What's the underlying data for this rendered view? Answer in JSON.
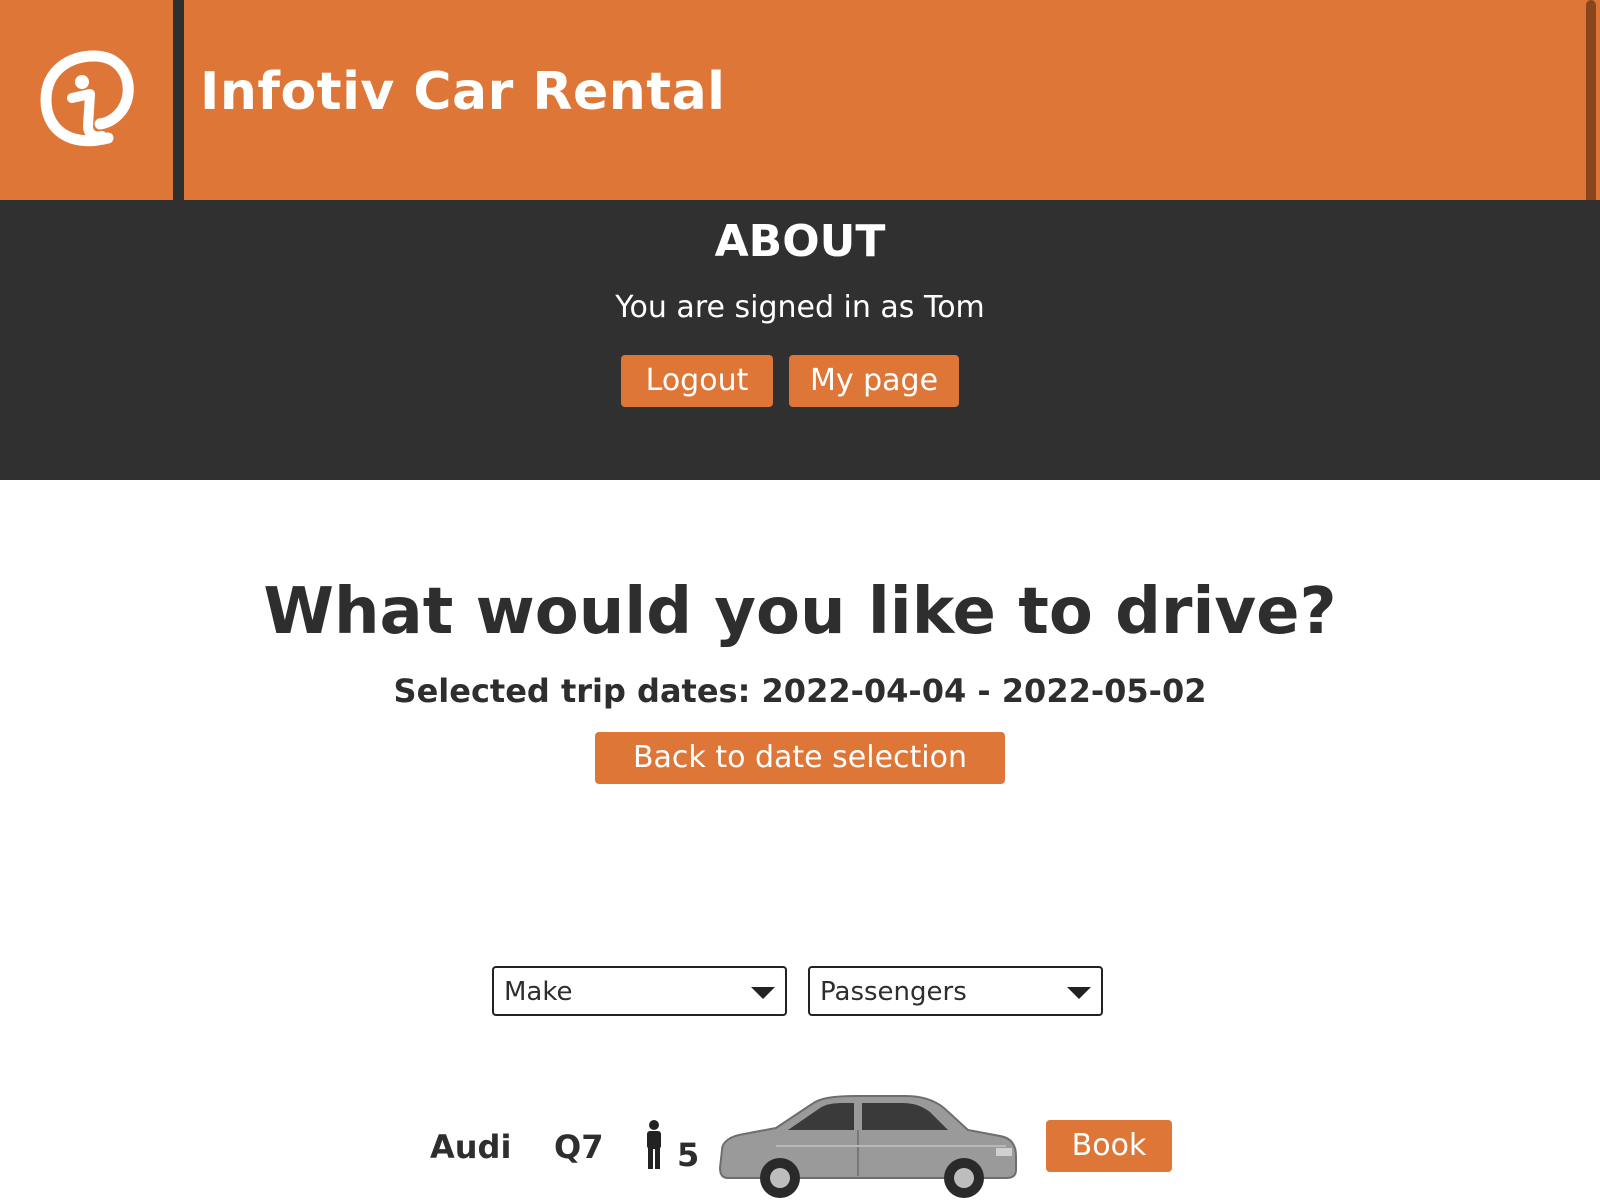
{
  "header": {
    "title": "Infotiv Car Rental",
    "logo_icon": "infotiv-logo-icon",
    "brand_color": "#de7638"
  },
  "about": {
    "heading": "ABOUT",
    "signed_in_text": "You are signed in as Tom",
    "logout_label": "Logout",
    "my_page_label": "My page"
  },
  "main": {
    "heading": "What would you like to drive?",
    "trip_dates": "Selected trip dates: 2022-04-04 - 2022-05-02",
    "back_label": "Back to date selection"
  },
  "filters": {
    "make_label": "Make",
    "passengers_label": "Passengers"
  },
  "cars": [
    {
      "make": "Audi",
      "model": "Q7",
      "passengers": "5",
      "passenger_icon": "person-icon",
      "image_icon": "car-image",
      "book_label": "Book"
    }
  ]
}
